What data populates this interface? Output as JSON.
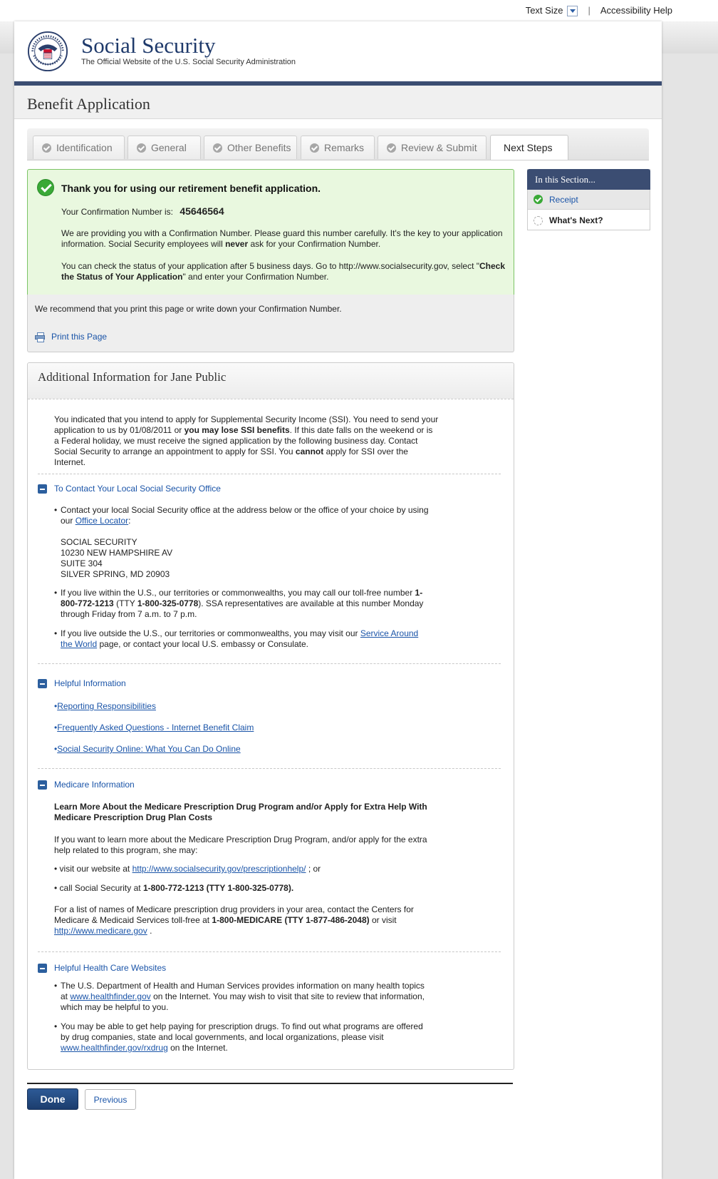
{
  "topbar": {
    "text_size": "Text Size",
    "separator": "|",
    "accessibility": "Accessibility Help"
  },
  "header": {
    "seal_alt": "SOCIAL SECURITY ADMINISTRATION USA",
    "title": "Social Security",
    "subtitle": "The Official Website of the U.S. Social Security Administration"
  },
  "page_title": "Benefit Application",
  "tabs": [
    {
      "label": "Identification"
    },
    {
      "label": "General"
    },
    {
      "label": "Other Benefits"
    },
    {
      "label": "Remarks"
    },
    {
      "label": "Review & Submit"
    },
    {
      "label": "Next Steps"
    }
  ],
  "success": {
    "thanks": "Thank you for using our retirement benefit application.",
    "conf_label": "Your Confirmation Number is:",
    "conf_number": "45646564",
    "p1a": "We are providing you with a Confirmation Number. Please guard this number carefully. It's the key to your application information. Social Security employees will ",
    "p1b": "never",
    "p1c": " ask for your Confirmation Number.",
    "p2a": "You can check the status of your application after 5 business days. Go to http://www.socialsecurity.gov, select \"",
    "p2b": "Check the Status of Your Application",
    "p2c": "\" and enter your Confirmation Number."
  },
  "print_box": {
    "recommend": "We recommend that you print this page or write down your Confirmation Number.",
    "print_label": "Print this Page"
  },
  "additional": {
    "title": "Additional Information for Jane Public",
    "ssi_a": "You indicated that you intend to apply for Supplemental Security Income (SSI). You need to send your application to us by 01/08/2011 or ",
    "ssi_b": "you may lose SSI benefits",
    "ssi_c": ". If this date falls on the weekend or is a Federal holiday, we must receive the signed application by the following business day. Contact Social Security to arrange an appointment to apply for SSI. You ",
    "ssi_d": "cannot",
    "ssi_e": " apply for SSI over the Internet.",
    "contact": {
      "heading": "To Contact Your Local Social Security Office",
      "b1a": "Contact your local Social Security office at the address below or the office of your choice by using our ",
      "b1_link": "Office Locator",
      "b1b": ":",
      "addr1": "SOCIAL SECURITY",
      "addr2": "10230 NEW HAMPSHIRE AV",
      "addr3": "SUITE 304",
      "addr4": "SILVER SPRING, MD 20903",
      "b2a": "If you live within the U.S., our territories or commonwealths, you may call our toll-free number ",
      "b2_phone": "1-800-772-1213",
      "b2b": " (TTY ",
      "b2_tty": "1-800-325-0778",
      "b2c": "). SSA representatives are available at this number Monday through Friday from 7 a.m. to 7 p.m.",
      "b3a": "If you live outside the U.S., our territories or commonwealths, you may visit our ",
      "b3_link": "Service Around the World",
      "b3b": " page, or contact your local U.S. embassy or Consulate."
    },
    "helpful": {
      "heading": "Helpful Information",
      "links": [
        "Reporting Responsibilities",
        "Frequently Asked Questions - Internet Benefit Claim",
        "Social Security Online: What You Can Do Online"
      ]
    },
    "medicare": {
      "heading": "Medicare Information",
      "bold": "Learn More About the Medicare Prescription Drug Program and/or Apply for Extra Help With Medicare Prescription Drug Plan Costs",
      "intro": "If you want to learn more about the Medicare Prescription Drug Program, and/or apply for the extra help related to this program, she may:",
      "b1a": "visit our website at ",
      "b1_link": "http://www.socialsecurity.gov/prescriptionhelp/",
      "b1b": " ; or",
      "b2a": "call Social Security at ",
      "b2b": "1-800-772-1213 (TTY 1-800-325-0778).",
      "list_a": "For a list of names of Medicare prescription drug providers in your area, contact the Centers for Medicare & Medicaid Services toll-free at ",
      "list_b": "1-800-MEDICARE (TTY 1-877-486-2048)",
      "list_c": " or visit ",
      "list_link": "http://www.medicare.gov",
      "list_d": " ."
    },
    "health": {
      "heading": "Helpful Health Care Websites",
      "b1a": "The U.S. Department of Health and Human Services provides information on many health topics at ",
      "b1_link": "www.healthfinder.gov",
      "b1b": " on the Internet. You may wish to visit that site to review that information, which may be helpful to you.",
      "b2a": "You may be able to get help paying for prescription drugs. To find out what programs are offered by drug companies, state and local governments, and local organizations, please visit ",
      "b2_link": "www.healthfinder.gov/rxdrug",
      "b2b": " on the Internet."
    }
  },
  "sidebar": {
    "heading": "In this Section...",
    "items": [
      "Receipt",
      "What's Next?"
    ]
  },
  "buttons": {
    "done": "Done",
    "previous": "Previous"
  },
  "bullet": "•",
  "colors": {
    "navy": "#3b4d72",
    "link": "#1a54a8",
    "success_bg": "#e9f8df",
    "success_border": "#7cc466"
  }
}
